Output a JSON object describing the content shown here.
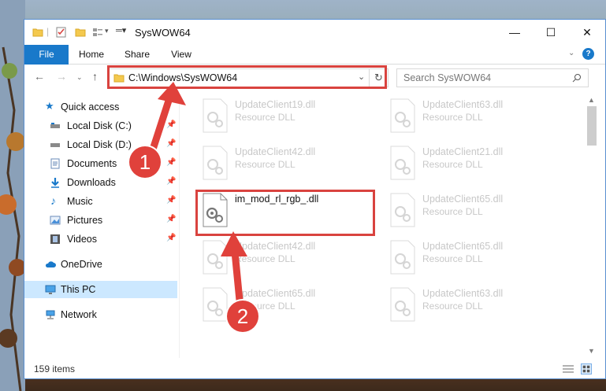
{
  "window": {
    "title": "SysWOW64"
  },
  "ribbon": {
    "tabs": [
      "File",
      "Home",
      "Share",
      "View"
    ]
  },
  "address": {
    "path": "C:\\Windows\\SysWOW64",
    "search_placeholder": "Search SysWOW64"
  },
  "sidebar": {
    "items": [
      {
        "label": "Quick access",
        "icon": "star-icon",
        "pinned": false
      },
      {
        "label": "Local Disk (C:)",
        "icon": "drive-icon",
        "pinned": true
      },
      {
        "label": "Local Disk (D:)",
        "icon": "drive-icon",
        "pinned": true
      },
      {
        "label": "Documents",
        "icon": "documents-icon",
        "pinned": true
      },
      {
        "label": "Downloads",
        "icon": "download-icon",
        "pinned": true
      },
      {
        "label": "Music",
        "icon": "music-icon",
        "pinned": true
      },
      {
        "label": "Pictures",
        "icon": "pictures-icon",
        "pinned": true
      },
      {
        "label": "Videos",
        "icon": "videos-icon",
        "pinned": true
      },
      {
        "label": "OneDrive",
        "icon": "cloud-icon",
        "pinned": false
      },
      {
        "label": "This PC",
        "icon": "computer-icon",
        "pinned": false,
        "selected": true
      },
      {
        "label": "Network",
        "icon": "network-icon",
        "pinned": false
      }
    ]
  },
  "files": [
    {
      "name": "UpdateClient19.dll",
      "type": "Resource DLL",
      "faded": true
    },
    {
      "name": "UpdateClient63.dll",
      "type": "Resource DLL",
      "faded": true
    },
    {
      "name": "UpdateClient42.dll",
      "type": "Resource DLL",
      "faded": true
    },
    {
      "name": "UpdateClient21.dll",
      "type": "Resource DLL",
      "faded": true
    },
    {
      "name": "im_mod_rl_rgb_.dll",
      "type": "",
      "faded": false
    },
    {
      "name": "UpdateClient65.dll",
      "type": "Resource DLL",
      "faded": true
    },
    {
      "name": "UpdateClient42.dll",
      "type": "Resource DLL",
      "faded": true
    },
    {
      "name": "UpdateClient65.dll",
      "type": "Resource DLL",
      "faded": true
    },
    {
      "name": "UpdateClient65.dll",
      "type": "Resource DLL",
      "faded": true
    },
    {
      "name": "UpdateClient63.dll",
      "type": "Resource DLL",
      "faded": true
    }
  ],
  "status": {
    "item_count": "159 items"
  },
  "annotations": {
    "step1": "1",
    "step2": "2",
    "color": "#e0413b"
  },
  "colors": {
    "file_tab": "#1979ca",
    "selected_nav": "#cce8ff"
  }
}
